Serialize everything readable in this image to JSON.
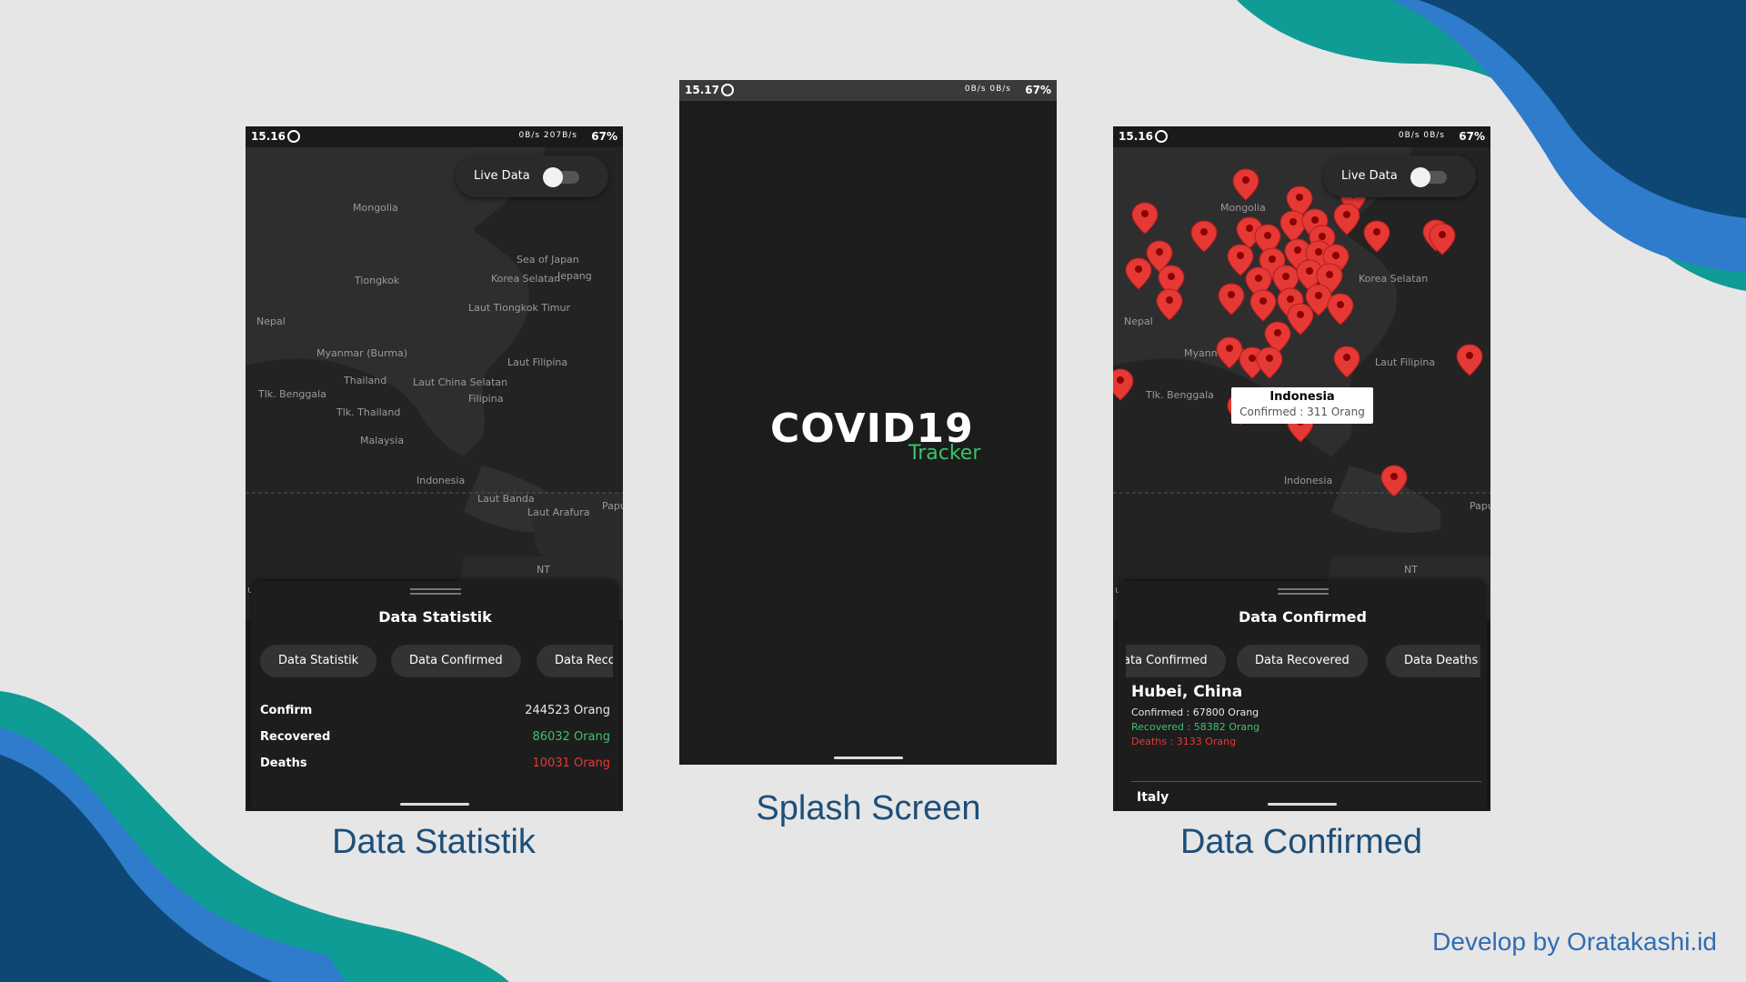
{
  "colors": {
    "background": "#e6e6e6",
    "teal": "#0f9c95",
    "blue": "#2f7ccc",
    "navy": "#0f4774",
    "phone_bg": "#1c1c1c",
    "accent_green": "#39c46a",
    "accent_red": "#e53935",
    "marker_red": "#e53935"
  },
  "screens": {
    "statistik": {
      "status": {
        "time": "15.16",
        "net": "0B/s 207B/s",
        "battery": "67%"
      },
      "toggle_label": "Live Data",
      "toggle_on": false,
      "map_labels": [
        "Mongolia",
        "Tiongkok",
        "Korea Selatan",
        "Sea of Japan",
        "Jepang",
        "Laut Tiongkok Timur",
        "Nepal",
        "Myanmar (Burma)",
        "Thailand",
        "Laut China Selatan",
        "Laut Filipina",
        "Filipina",
        "Tlk. Benggala",
        "Tlk. Thailand",
        "Malaysia",
        "Indonesia",
        "Laut Banda",
        "Laut Arafura",
        "Papua Nugini",
        "NT",
        "udra"
      ],
      "sheet_title": "Data Statistik",
      "chips": [
        "Data Statistik",
        "Data Confirmed",
        "Data Recovered"
      ],
      "rows": [
        {
          "label": "Confirm",
          "value": "244523 Orang",
          "color": "#e8e8e8"
        },
        {
          "label": "Recovered",
          "value": "86032 Orang",
          "color": "#39c46a"
        },
        {
          "label": "Deaths",
          "value": "10031 Orang",
          "color": "#e53935"
        }
      ],
      "caption": "Data Statistik"
    },
    "splash": {
      "status": {
        "time": "15.17",
        "net": "0B/s 0B/s",
        "battery": "67%"
      },
      "title": "COVID19",
      "subtitle": "Tracker",
      "caption": "Splash Screen"
    },
    "confirmed": {
      "status": {
        "time": "15.16",
        "net": "0B/s 0B/s",
        "battery": "67%"
      },
      "toggle_label": "Live Data",
      "popup": {
        "title": "Indonesia",
        "subtitle": "Confirmed : 311 Orang"
      },
      "sheet_title": "Data Confirmed",
      "chips": [
        "Data Confirmed",
        "Data Recovered",
        "Data Deaths"
      ],
      "item": {
        "name": "Hubei, China",
        "confirmed": "Confirmed : 67800 Orang",
        "recovered": "Recovered : 58382 Orang",
        "deaths": "Deaths : 3133 Orang"
      },
      "next_item": "Italy",
      "caption": "Data Confirmed"
    }
  },
  "credit": "Develop by Oratakashi.id"
}
